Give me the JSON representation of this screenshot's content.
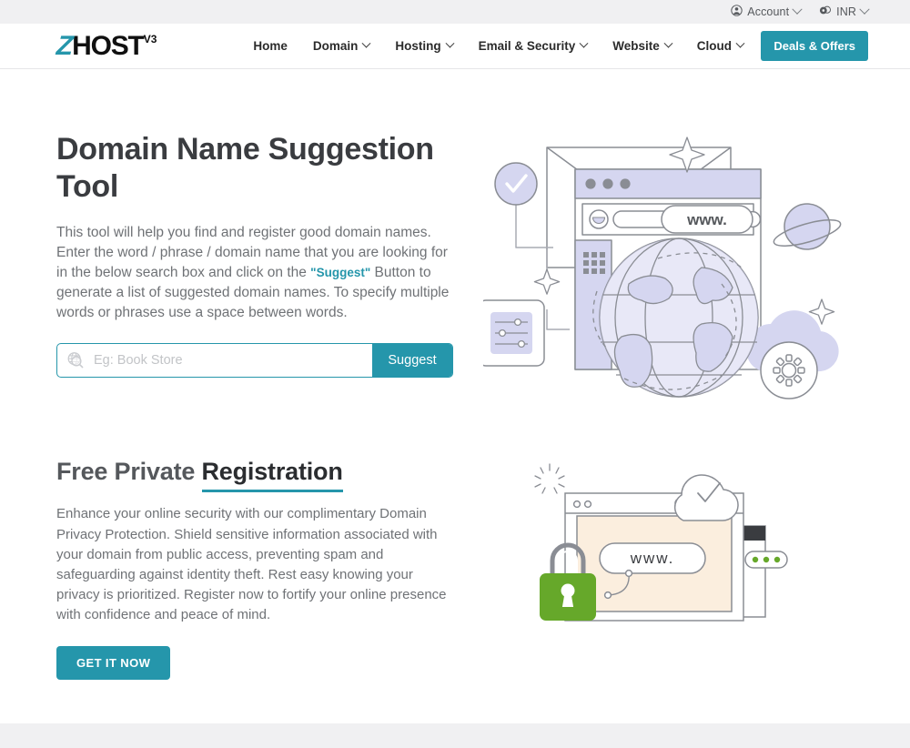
{
  "topbar": {
    "items": [
      {
        "label": "Account",
        "icon": "user-circle-icon"
      },
      {
        "label": "INR",
        "icon": "coins-icon"
      }
    ]
  },
  "header": {
    "logo": {
      "mark": "Z",
      "name": "HOST",
      "version": "V3"
    },
    "nav": [
      {
        "label": "Home",
        "has_caret": false
      },
      {
        "label": "Domain",
        "has_caret": true
      },
      {
        "label": "Hosting",
        "has_caret": true
      },
      {
        "label": "Email & Security",
        "has_caret": true
      },
      {
        "label": "Website",
        "has_caret": true
      },
      {
        "label": "Cloud",
        "has_caret": true
      }
    ],
    "deals_label": "Deals & Offers"
  },
  "hero": {
    "title": "Domain Name Suggestion Tool",
    "paragraph_part1": "This tool will help you find and register good domain names. Enter the word / phrase / domain name that you are looking for in the below search box and click on the ",
    "paragraph_highlight": "\"Suggest\"",
    "paragraph_part2": " Button to generate a list of suggested domain names. To specify multiple words or phrases use a space between words.",
    "search": {
      "placeholder": "Eg: Book Store",
      "value": "",
      "icon": "globe-search-icon",
      "button_label": "Suggest"
    },
    "illustration": {
      "name": "domain-search-illustration",
      "www_label": "www."
    }
  },
  "privacy": {
    "title_plain": "Free Private ",
    "title_accent": "Registration",
    "body": "Enhance your online security with our complimentary Domain Privacy Protection. Shield sensitive information associated with your domain from public access, preventing spam and safeguarding against identity theft. Rest easy knowing your privacy is prioritized. Register now to fortify your online presence with confidence and peace of mind.",
    "cta_label": "GET IT NOW",
    "illustration": {
      "name": "private-registration-illustration",
      "www_label": "www."
    }
  },
  "colors": {
    "accent_teal": "#2596ab",
    "green": "#66a82a",
    "lavender": "#d5d6f0",
    "cream": "#fbeede",
    "band_gray": "#f0f0f2",
    "heading_gray": "#3a3c40",
    "body_gray": "#6f7276"
  }
}
